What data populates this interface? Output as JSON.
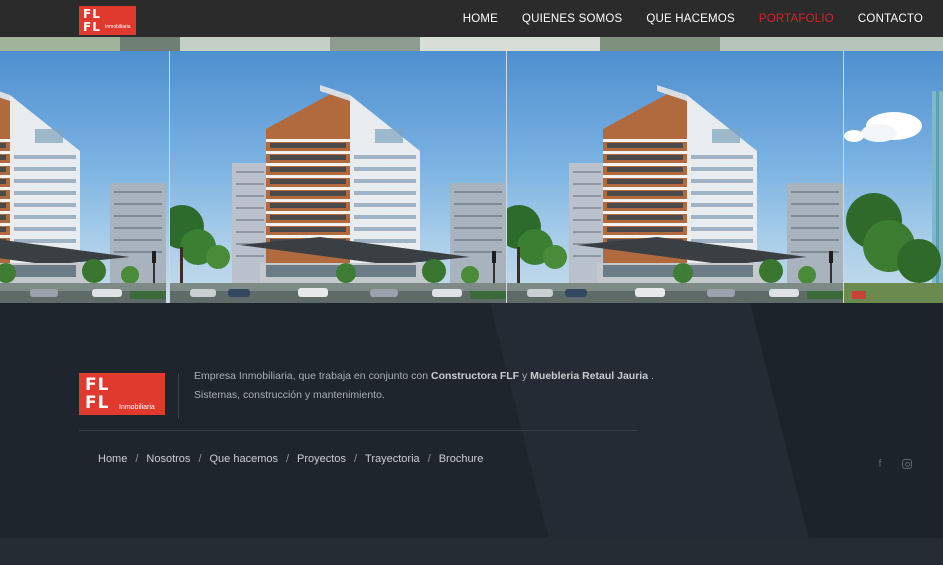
{
  "header": {
    "logo": {
      "line1": "FL",
      "line2": "FL",
      "sub": "Inmobiliaria"
    },
    "nav": [
      {
        "label": "HOME",
        "active": false
      },
      {
        "label": "QUIENES SOMOS",
        "active": false
      },
      {
        "label": "QUE HACEMOS",
        "active": false
      },
      {
        "label": "PORTAFOLIO",
        "active": true
      },
      {
        "label": "CONTACTO",
        "active": false
      }
    ]
  },
  "footer": {
    "logo": {
      "line1": "FL",
      "line2": "FL",
      "sub": "Inmobiliaria"
    },
    "description": {
      "part1": "Empresa Inmobiliaria, que trabaja en conjunto con ",
      "bold1": "Constructora FLF",
      "part2": " y ",
      "bold2": "Muebleria Retaul Jauria",
      "part3": " .",
      "line2": "Sistemas, construcción y mantenimiento."
    },
    "links": [
      "Home",
      "Nosotros",
      "Que hacemos",
      "Proyectos",
      "Trayectoria",
      "Brochure"
    ],
    "separator": "/",
    "social": [
      {
        "name": "facebook-icon",
        "glyph": "f"
      },
      {
        "name": "instagram-icon",
        "glyph": ""
      }
    ]
  },
  "colors": {
    "header_bg": "#2b2b2b",
    "accent_red": "#e03a2e",
    "active_nav": "#d4232a",
    "footer_bg": "#1f252d"
  }
}
